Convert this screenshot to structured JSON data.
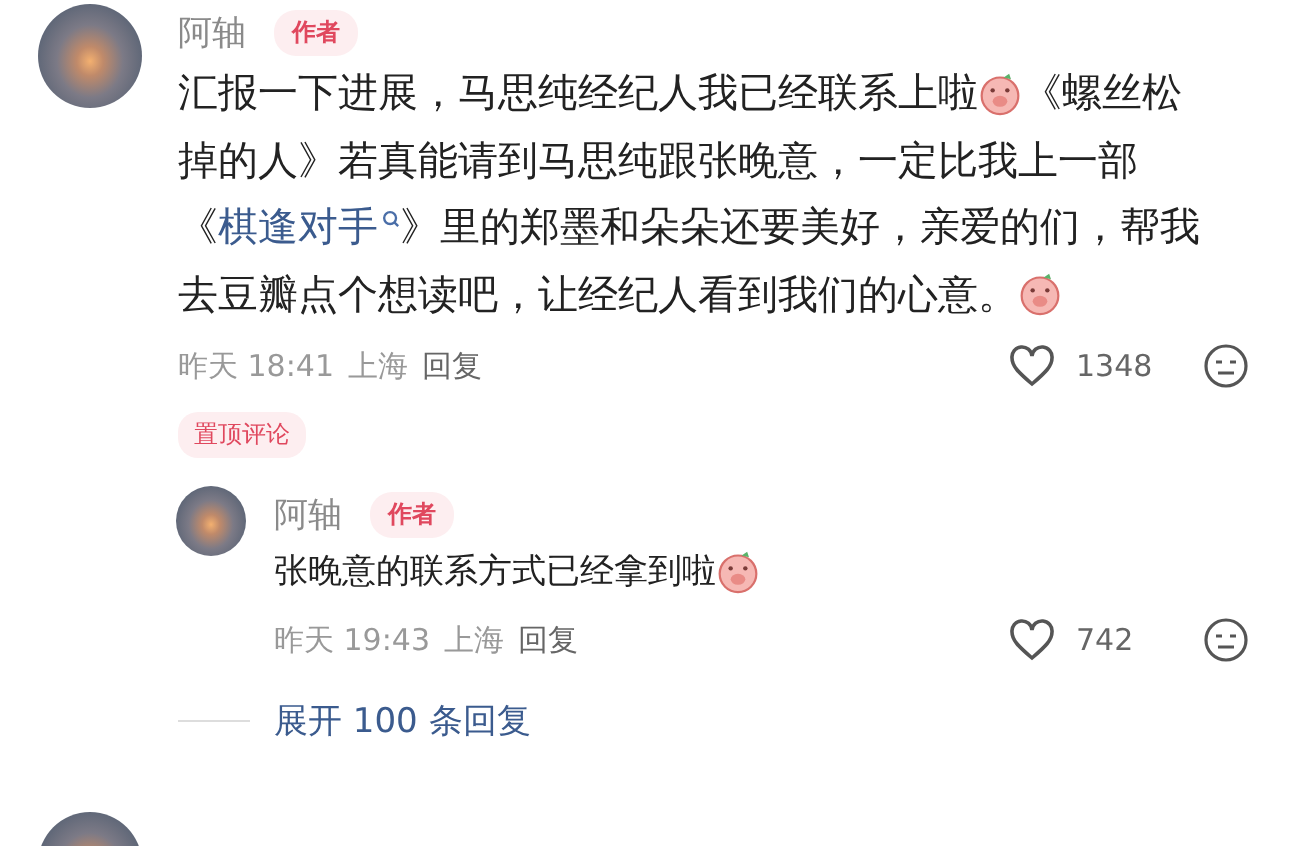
{
  "comment": {
    "author": "阿轴",
    "badge": "作者",
    "lines": [
      [
        {
          "kind": "text",
          "text": "汇报一下进展，马思纯经纪人我已经联系上啦"
        },
        {
          "kind": "emoji"
        },
        {
          "kind": "text",
          "text": "《螺丝松"
        }
      ],
      [
        {
          "kind": "text",
          "text": "掉的人》若真能请到马思纯跟张晚意，一定比我上一部"
        }
      ],
      [
        {
          "kind": "text",
          "text": "《 "
        },
        {
          "kind": "link",
          "text": "棋逢对手"
        },
        {
          "kind": "text",
          "text": " 》里的郑墨和朵朵还要美好，亲爱的们，帮我"
        }
      ],
      [
        {
          "kind": "text",
          "text": "去豆瓣点个想读吧，让经纪人看到我们的心意。"
        },
        {
          "kind": "emoji"
        }
      ]
    ],
    "time": "昨天 18:41",
    "location": "上海",
    "reply_label": "回复",
    "likes": "1348",
    "pinned_label": "置顶评论",
    "reply": {
      "author": "阿轴",
      "badge": "作者",
      "content": [
        {
          "kind": "text",
          "text": "张晚意的联系方式已经拿到啦"
        },
        {
          "kind": "emoji"
        }
      ],
      "time": "昨天 19:43",
      "location": "上海",
      "reply_label": "回复",
      "likes": "742"
    },
    "expand_label": "展开 100 条回复"
  }
}
